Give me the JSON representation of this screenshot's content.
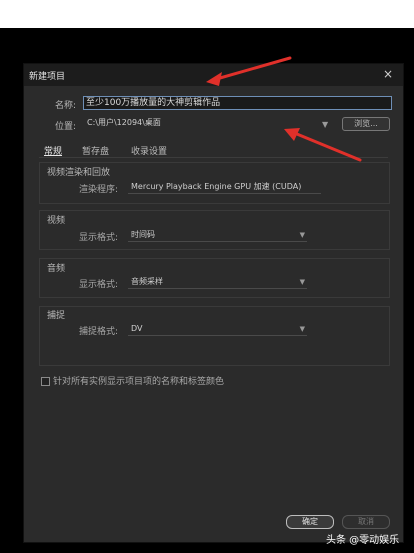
{
  "dialog": {
    "title": "新建项目",
    "close_glyph": "×"
  },
  "form": {
    "name_label": "名称:",
    "name_value": "至少100万播放量的大神剪辑作品",
    "location_label": "位置:",
    "location_value": "C:\\用户\\12094\\桌面",
    "browse_label": "浏览..."
  },
  "tabs": [
    {
      "label": "常规",
      "active": true
    },
    {
      "label": "暂存盘",
      "active": false
    },
    {
      "label": "收录设置",
      "active": false
    }
  ],
  "sections": {
    "render": {
      "title": "视频渲染和回放",
      "field_label": "渲染程序:",
      "value": "Mercury Playback Engine GPU 加速 (CUDA)"
    },
    "video": {
      "title": "视频",
      "field_label": "显示格式:",
      "value": "时间码"
    },
    "audio": {
      "title": "音频",
      "field_label": "显示格式:",
      "value": "音频采样"
    },
    "capture": {
      "title": "捕捉",
      "field_label": "捕捉格式:",
      "value": "DV"
    }
  },
  "checkbox_label": "针对所有实例显示项目项的名称和标签颜色",
  "buttons": {
    "ok": "确定",
    "cancel": "取消"
  },
  "watermark": "头条 @零动娱乐",
  "colors": {
    "annotation_arrow": "#e0302a",
    "name_border": "#6e8fb7"
  }
}
